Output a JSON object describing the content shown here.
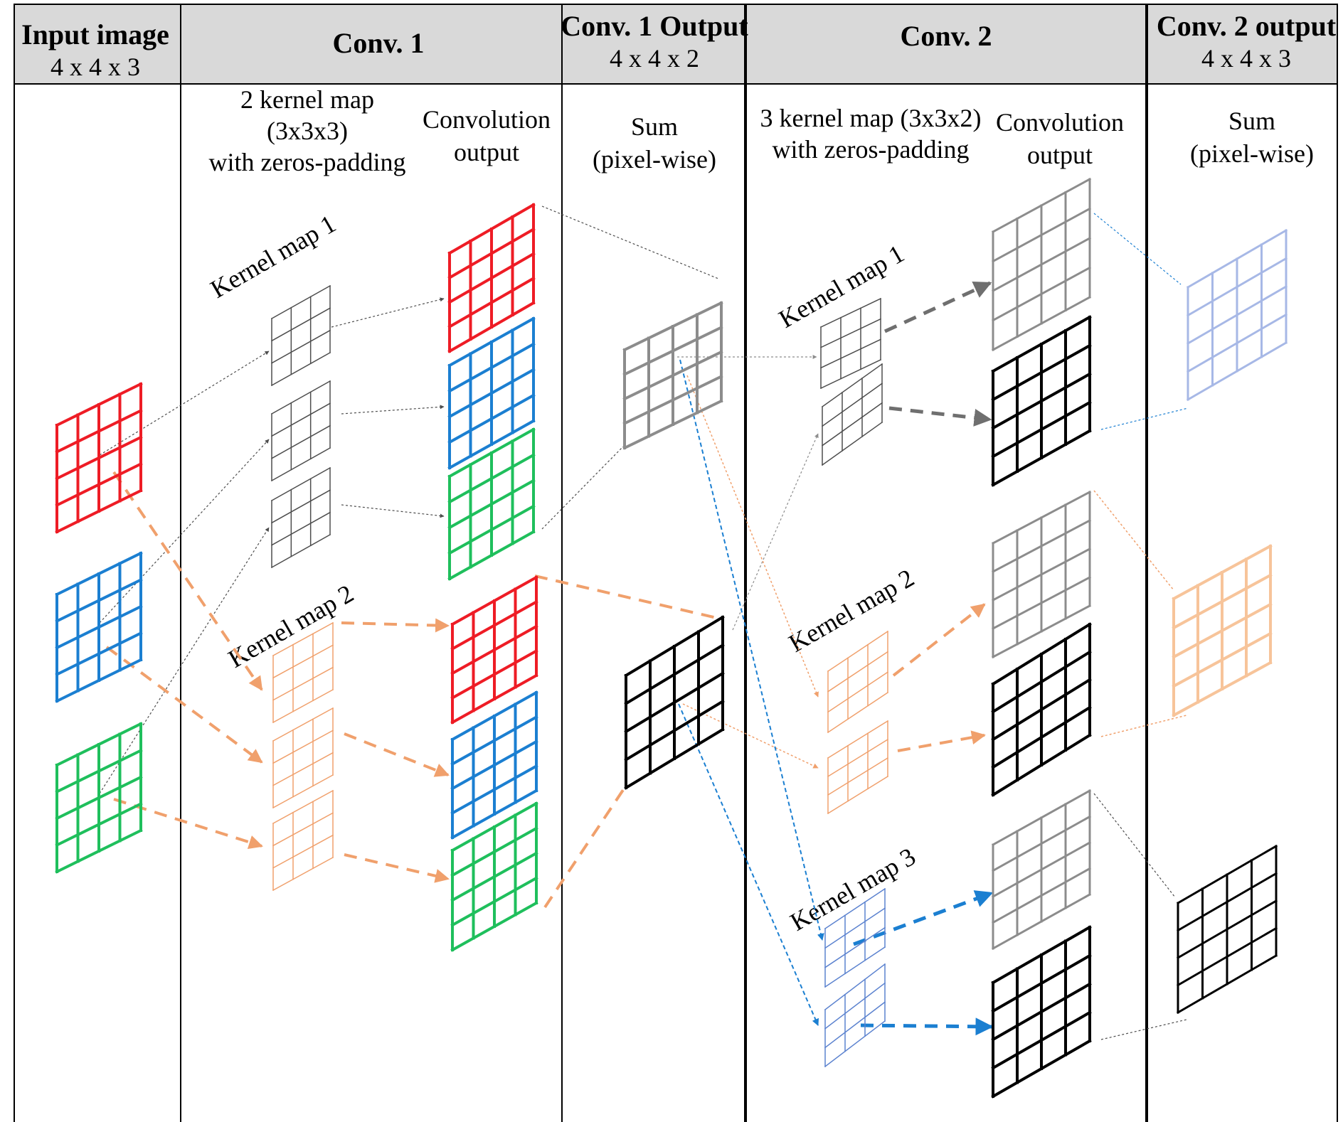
{
  "headers": {
    "input": {
      "title": "Input image",
      "dims": "4 x 4 x 3"
    },
    "conv1": {
      "title": "Conv. 1"
    },
    "conv1_output": {
      "title": "Conv. 1 Output",
      "dims": "4 x 4 x 2"
    },
    "conv2": {
      "title": "Conv. 2"
    },
    "conv2_output": {
      "title": "Conv. 2 output",
      "dims": "4 x 4 x 3"
    }
  },
  "descriptions": {
    "conv1_kernels": [
      "2 kernel map",
      "(3x3x3)",
      "with zeros-padding"
    ],
    "conv1_convout": [
      "Convolution",
      "output"
    ],
    "conv1_sum": [
      "Sum",
      "(pixel-wise)"
    ],
    "conv2_kernels": [
      "3 kernel map (3x3x2)",
      "with zeros-padding"
    ],
    "conv2_convout": [
      "Convolution",
      "output"
    ],
    "conv2_sum": [
      "Sum",
      "(pixel-wise)"
    ]
  },
  "kernel_labels": {
    "conv1_k1": "Kernel map 1",
    "conv1_k2": "Kernel map 2",
    "conv2_k1": "Kernel map 1",
    "conv2_k2": "Kernel map 2",
    "conv2_k3": "Kernel map 3"
  },
  "colors": {
    "red": "#ee1c25",
    "blue": "#1b7fd1",
    "green": "#1fbf5c",
    "gray": "#8c8c8c",
    "black": "#000000",
    "thin_black": "#4d4d4d",
    "orange": "#f0a06c",
    "light_blue": "#a7b8e6",
    "light_orange": "#f7c49a",
    "kernel_blue": "#5b82cf",
    "header_bg": "#d9d9d9"
  }
}
